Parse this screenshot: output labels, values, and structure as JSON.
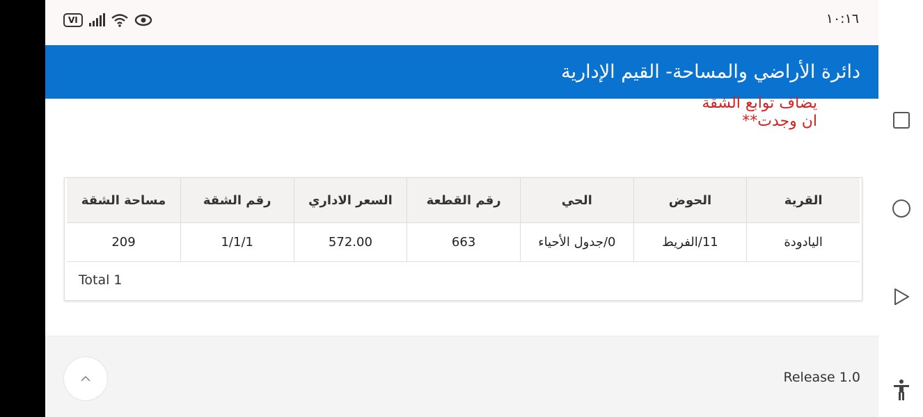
{
  "status_bar": {
    "carrier_badge": "VI",
    "time": "١٠:١٦",
    "icons": [
      "signal-icon",
      "wifi-icon",
      "eye-icon"
    ]
  },
  "header": {
    "title": "دائرة الأراضي والمساحة- القيم الإدارية",
    "background": "#0a72cf"
  },
  "note": {
    "line1": "يضاف توابع الشقة",
    "line2": "ان وجدت**",
    "color": "#d71f1f"
  },
  "table": {
    "columns": [
      "القرية",
      "الحوض",
      "الحي",
      "رقم القطعة",
      "السعر الاداري",
      "رقم الشقة",
      "مساحة الشقة"
    ],
    "rows": [
      [
        "اليادودة",
        "11/الفريط",
        "0/جدول الأحياء",
        "663",
        "572.00",
        "1/1/1",
        "209"
      ]
    ],
    "total_label": "Total 1"
  },
  "footer": {
    "release": "Release 1.0"
  },
  "nav": {
    "icons": [
      "recent-apps-icon",
      "home-icon",
      "back-icon",
      "accessibility-icon"
    ]
  }
}
